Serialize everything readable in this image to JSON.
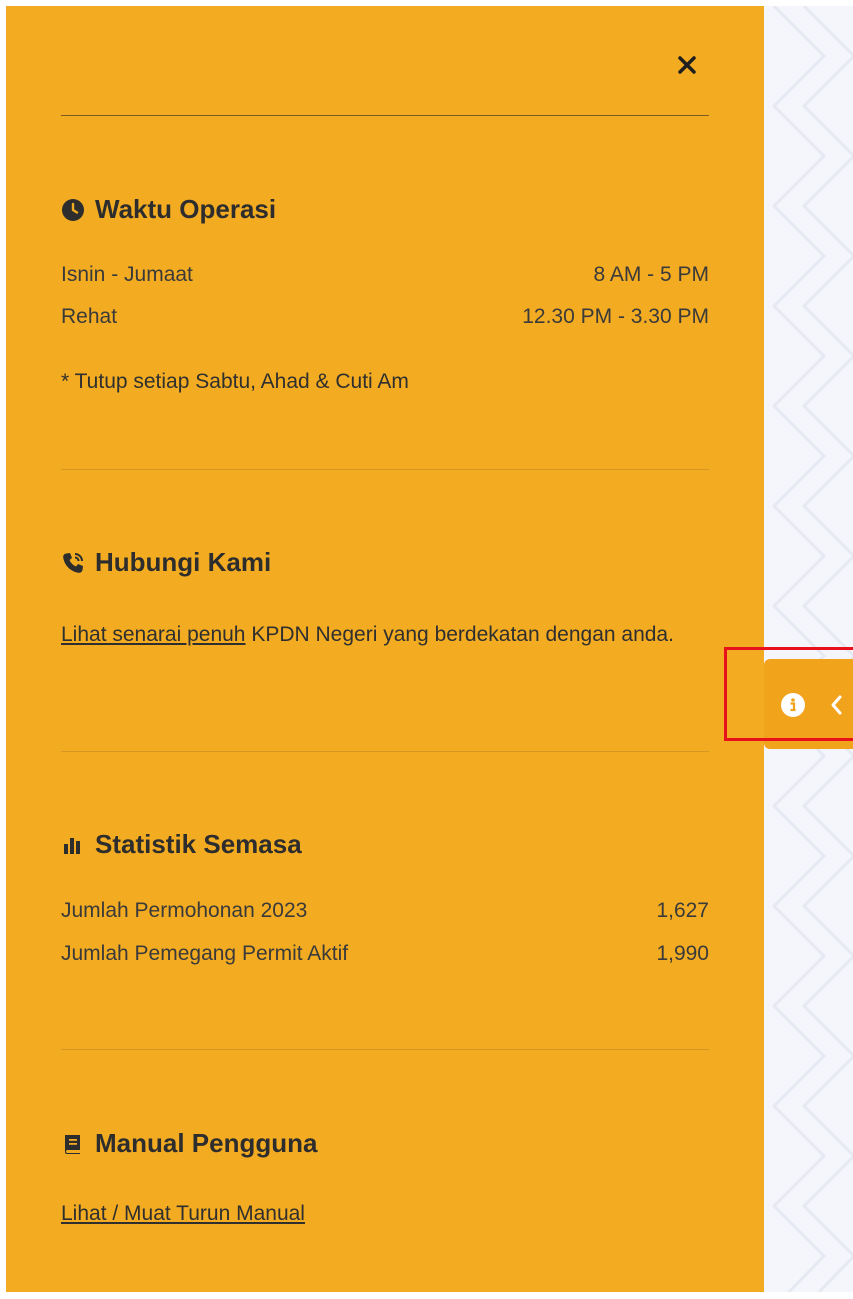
{
  "panel": {
    "close_icon": "close-icon",
    "colors": {
      "panel_bg": "#f3ac21",
      "tab_bg": "#f0a31b",
      "highlight": "#e8101b",
      "text": "#2d2d2d"
    }
  },
  "operating_hours": {
    "icon": "clock-icon",
    "title": "Waktu Operasi",
    "rows": [
      {
        "label": "Isnin - Jumaat",
        "value": "8 AM - 5 PM"
      },
      {
        "label": "Rehat",
        "value": "12.30 PM - 3.30 PM"
      }
    ],
    "note": "* Tutup setiap Sabtu, Ahad & Cuti Am"
  },
  "contact": {
    "icon": "phone-icon",
    "title": "Hubungi Kami",
    "link_text": "Lihat senarai penuh",
    "text_after_link": " KPDN Negeri yang berdekatan dengan anda."
  },
  "statistics": {
    "icon": "bar-chart-icon",
    "title": "Statistik Semasa",
    "rows": [
      {
        "label": "Jumlah Permohonan 2023",
        "value": "1,627"
      },
      {
        "label": "Jumlah Pemegang Permit Aktif",
        "value": "1,990"
      }
    ]
  },
  "manual": {
    "icon": "book-icon",
    "title": "Manual Pengguna",
    "link_text": "Lihat / Muat Turun Manual"
  },
  "side_tab": {
    "icons": [
      "info-icon",
      "chevron-left-icon"
    ]
  }
}
